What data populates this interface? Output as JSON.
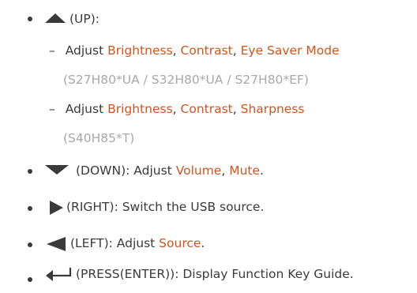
{
  "items": [
    {
      "icon": "up-arrow-icon",
      "text": "(UP):"
    },
    {
      "icon": "down-arrow-icon",
      "pre": "(DOWN): Adjust ",
      "h1": "Volume",
      "sep": ", ",
      "h2": "Mute",
      "post": "."
    },
    {
      "icon": "right-arrow-icon",
      "text": "(RIGHT): Switch the USB source."
    },
    {
      "icon": "left-arrow-icon",
      "pre": "(LEFT): Adjust ",
      "h1": "Source",
      "post": "."
    },
    {
      "icon": "enter-icon",
      "text": "(PRESS(ENTER)): Display Function Key Guide."
    }
  ],
  "sub": [
    {
      "dash": "–",
      "pre": "Adjust ",
      "h1": "Brightness",
      "s1": ", ",
      "h2": "Contrast",
      "s2": ", ",
      "h3": "Eye Saver Mode",
      "models": "(S27H80*UA / S32H80*UA / S27H80*EF)"
    },
    {
      "dash": "–",
      "pre": "Adjust ",
      "h1": "Brightness",
      "s1": ", ",
      "h2": "Contrast",
      "s2": ", ",
      "h3": "Sharpness",
      "models": "(S40H85*T)"
    }
  ],
  "colors": {
    "highlight": "#d2541b",
    "text": "#3a3a3a",
    "muted": "#a8a8a8"
  }
}
